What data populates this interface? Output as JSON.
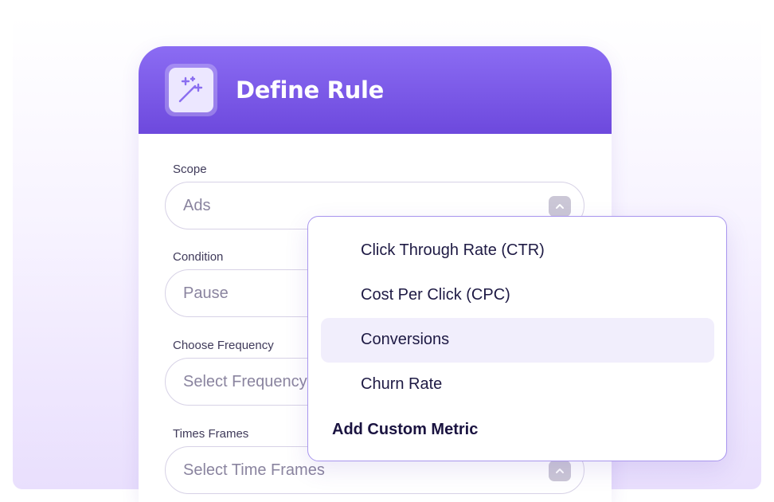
{
  "header": {
    "title": "Define Rule",
    "icon": "magic-wand-icon"
  },
  "form": {
    "scope": {
      "label": "Scope",
      "value": "Ads"
    },
    "condition": {
      "label": "Condition",
      "value": "Pause"
    },
    "frequency": {
      "label": "Choose Frequency",
      "placeholder": "Select Frequency"
    },
    "time_frames": {
      "label": "Times Frames",
      "placeholder": "Select Time Frames"
    }
  },
  "dropdown": {
    "options": [
      {
        "label": "Click Through Rate (CTR)"
      },
      {
        "label": "Cost Per Click (CPC)"
      },
      {
        "label": "Conversions",
        "highlighted": true
      },
      {
        "label": "Churn Rate"
      }
    ],
    "add_label": "Add Custom Metric"
  },
  "colors": {
    "header_gradient_top": "#8b6cf3",
    "header_gradient_bottom": "#6d49dd",
    "dropdown_border": "#a895ee",
    "highlight": "#f1eefc"
  }
}
